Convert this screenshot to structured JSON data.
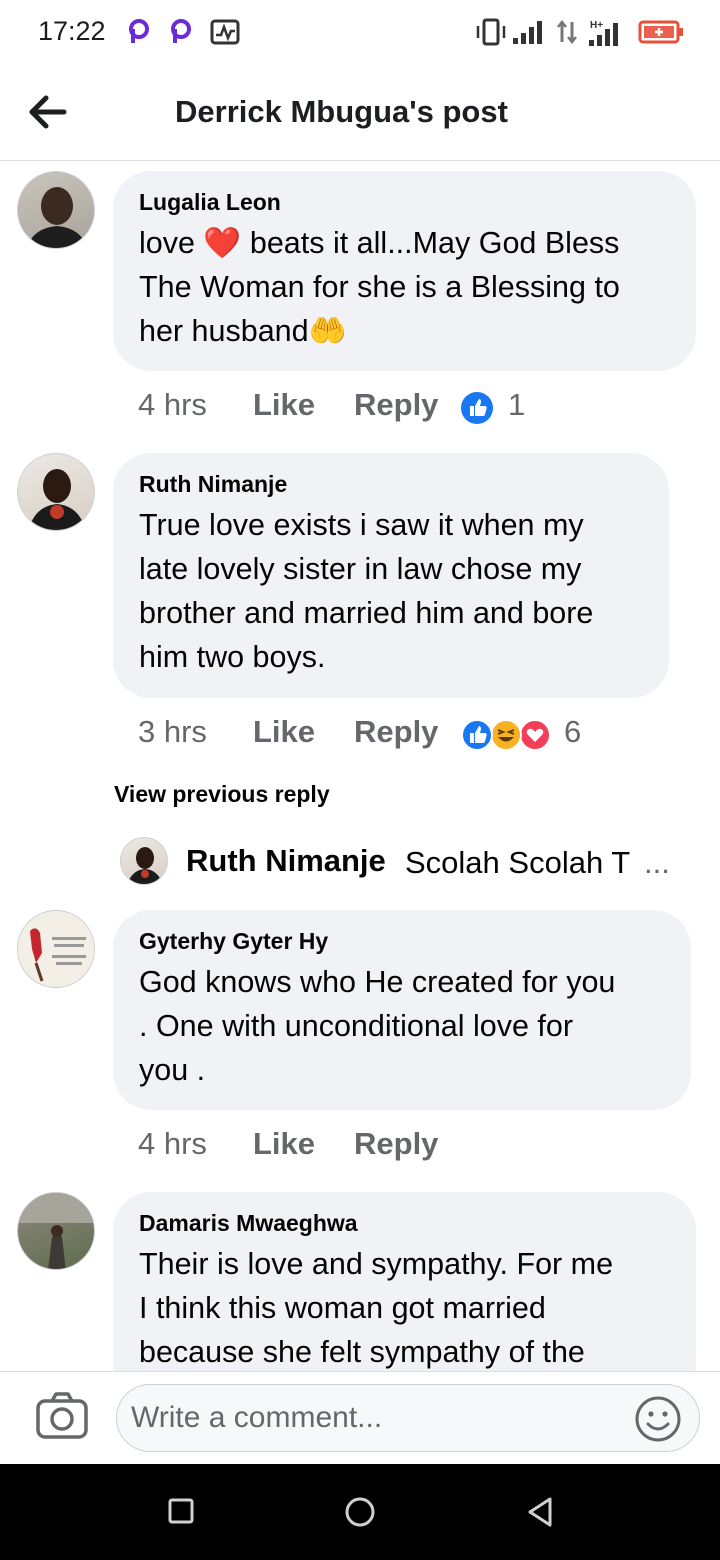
{
  "status_bar": {
    "time": "17:22"
  },
  "header": {
    "title": "Derrick Mbugua's post"
  },
  "comments": [
    {
      "name": "Lugalia Leon",
      "text_lines": [
        "love ❤️ beats it all...May God Bless",
        "The Woman for she is a Blessing to",
        "her husband🤲"
      ],
      "time": "4 hrs",
      "like": "Like",
      "reply": "Reply",
      "reaction_count": "1"
    },
    {
      "name": "Ruth Nimanje",
      "text_lines": [
        "True love exists i saw it when my",
        "late lovely sister in law chose my",
        "brother and married him and bore",
        "him two boys."
      ],
      "time": "3 hrs",
      "like": "Like",
      "reply": "Reply",
      "reaction_count": "6"
    },
    {
      "name": "Gyterhy Gyter Hy",
      "text_lines": [
        "God knows who He created for you",
        ". One with unconditional love for",
        "you ."
      ],
      "time": "4 hrs",
      "like": "Like",
      "reply": "Reply"
    },
    {
      "name": "Damaris Mwaeghwa",
      "text_lines": [
        "Their is love and sympathy.  For me",
        "I think this woman got married",
        "because she felt sympathy of the"
      ]
    }
  ],
  "view_previous": "View previous reply",
  "reply_preview": {
    "name": "Ruth Nimanje",
    "text": "Scolah Scolah T",
    "ellipsis": "..."
  },
  "composer": {
    "placeholder": "Write a comment..."
  },
  "colors": {
    "like_blue": "#1877f2",
    "bubble": "#f0f2f5",
    "muted": "#65676b",
    "heart": "#f33e58",
    "haha": "#f7b125"
  }
}
